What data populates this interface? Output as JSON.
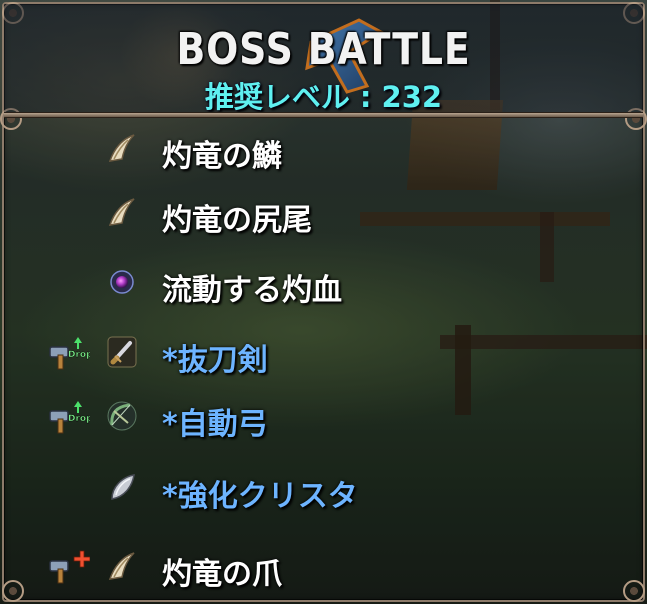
{
  "header": {
    "title": "BOSS BATTLE",
    "level_label": "推奨レベル",
    "level_separator": ":",
    "level_value": "232"
  },
  "items": [
    {
      "label": "灼竜の鱗",
      "icon": "claw-icon",
      "rare": false,
      "drop_badge": null
    },
    {
      "label": "灼竜の尻尾",
      "icon": "claw-icon",
      "rare": false,
      "drop_badge": null
    },
    {
      "label": "流動する灼血",
      "icon": "orb-icon",
      "rare": false,
      "drop_badge": null
    },
    {
      "label": "*抜刀剣",
      "icon": "sword-icon",
      "rare": true,
      "drop_badge": "Drop"
    },
    {
      "label": "*自動弓",
      "icon": "bow-icon",
      "rare": true,
      "drop_badge": "Drop"
    },
    {
      "label": "*強化クリスタ",
      "icon": "crystal-icon",
      "rare": true,
      "drop_badge": null
    },
    {
      "label": "灼竜の爪",
      "icon": "claw-icon",
      "rare": false,
      "drop_badge": "plus"
    }
  ],
  "colors": {
    "title": "#f2f2f2",
    "level": "#5ff0f0",
    "normal_item": "#ffffff",
    "rare_item": "#6db4ff",
    "frame": "#8d7b6a"
  }
}
